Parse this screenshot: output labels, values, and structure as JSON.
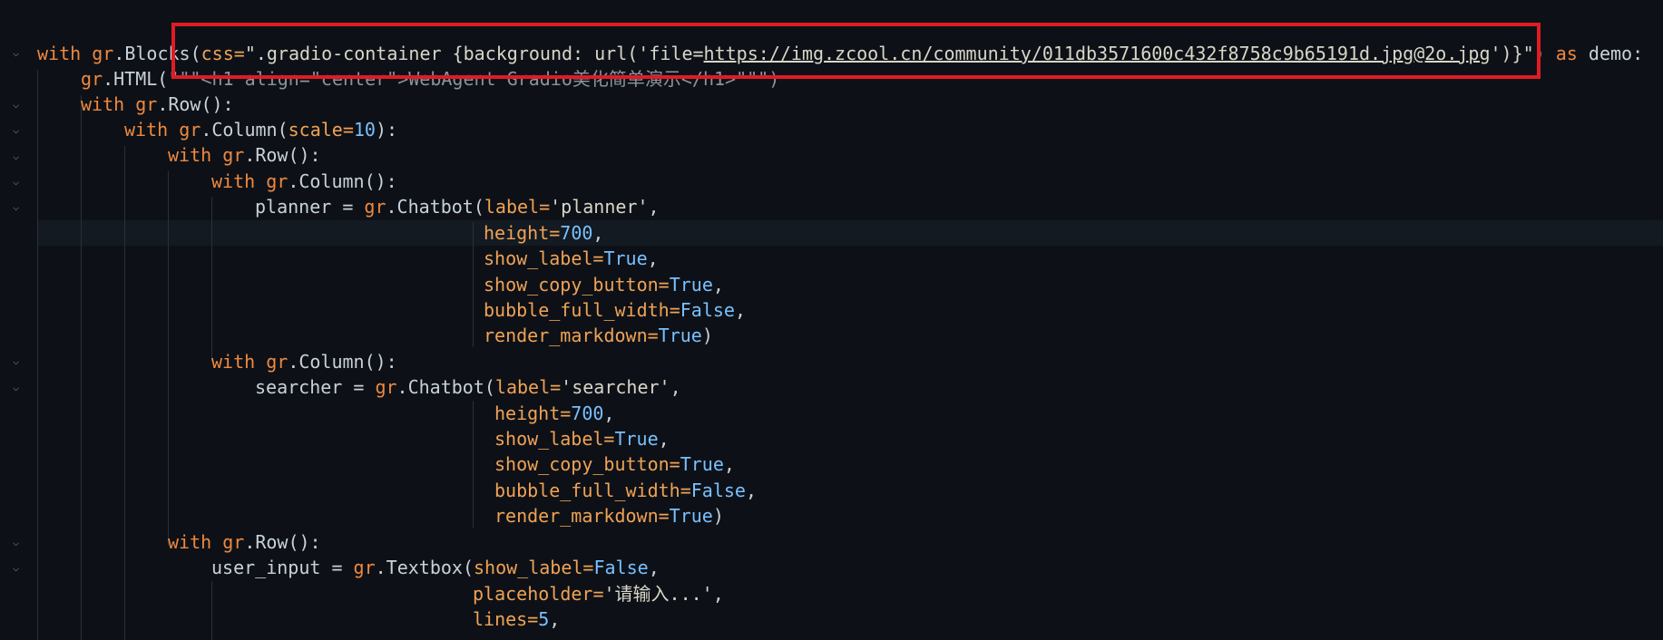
{
  "code": {
    "l1": {
      "kw1": "with",
      "mod1": "gr",
      "fn1": ".Blocks(",
      "p1": "css=",
      "s1": "\".gradio-container {background: url('file=",
      "url": "https://img.zcool.cn/community/011db3571600c432f8758c9b65191d.jpg@2o.jpg",
      "s2": "')}\")",
      "kw2": "as",
      "rest": "demo:"
    },
    "l2": {
      "mod": "gr",
      "fn": ".HTML(",
      "s": "\"\"\"<h1 align=\"center\">WebAgent Gradio美化简单演示</h1>\"\"\")"
    },
    "l3": {
      "kw": "with",
      "mod": "gr",
      "fn": ".Row():"
    },
    "l4": {
      "kw": "with",
      "mod": "gr",
      "fn": ".Column(",
      "p": "scale=",
      "n": "10",
      "end": "):"
    },
    "l5": {
      "kw": "with",
      "mod": "gr",
      "fn": ".Row():"
    },
    "l6": {
      "kw": "with",
      "mod": "gr",
      "fn": ".Column():"
    },
    "l7": {
      "var": "planner = ",
      "mod": "gr",
      "fn": ".Chatbot(",
      "p": "label=",
      "s": "'planner'",
      "end": ","
    },
    "l8": {
      "p": "height=",
      "v": "700",
      "end": ","
    },
    "l9": {
      "p": "show_label=",
      "v": "True",
      "end": ","
    },
    "l10": {
      "p": "show_copy_button=",
      "v": "True",
      "end": ","
    },
    "l11": {
      "p": "bubble_full_width=",
      "v": "False",
      "end": ","
    },
    "l12": {
      "p": "render_markdown=",
      "v": "True",
      "end": ")"
    },
    "l13": {
      "kw": "with",
      "mod": "gr",
      "fn": ".Column():"
    },
    "l14": {
      "var": "searcher = ",
      "mod": "gr",
      "fn": ".Chatbot(",
      "p": "label=",
      "s": "'searcher'",
      "end": ","
    },
    "l15": {
      "p": "height=",
      "v": "700",
      "end": ","
    },
    "l16": {
      "p": "show_label=",
      "v": "True",
      "end": ","
    },
    "l17": {
      "p": "show_copy_button=",
      "v": "True",
      "end": ","
    },
    "l18": {
      "p": "bubble_full_width=",
      "v": "False",
      "end": ","
    },
    "l19": {
      "p": "render_markdown=",
      "v": "True",
      "end": ")"
    },
    "l20": {
      "kw": "with",
      "mod": "gr",
      "fn": ".Row():"
    },
    "l21": {
      "var": "user_input = ",
      "mod": "gr",
      "fn": ".Textbox(",
      "p": "show_label=",
      "v": "False",
      "end": ","
    },
    "l22": {
      "p": "placeholder=",
      "s": "'请输入...'",
      "end": ","
    },
    "l23": {
      "p": "lines=",
      "v": "5",
      "end": ","
    }
  }
}
